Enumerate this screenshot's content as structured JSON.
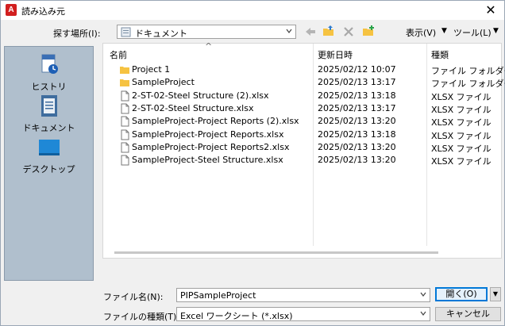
{
  "window": {
    "title": "読み込み元",
    "app_icon_letter": "A",
    "close_symbol": "✕"
  },
  "toolbar": {
    "lookin_label": "探す場所(I):",
    "lookin_value": "ドキュメント",
    "view_label": "表示(V)",
    "tools_label": "ツール(L)",
    "menu_arrow": "▼"
  },
  "places": [
    {
      "label": "ヒストリ",
      "icon": "history-icon"
    },
    {
      "label": "ドキュメント",
      "icon": "documents-icon"
    },
    {
      "label": "デスクトップ",
      "icon": "desktop-icon"
    }
  ],
  "columns": {
    "sort_arrow": "^",
    "name": "名前",
    "date": "更新日時",
    "type": "種類"
  },
  "files": [
    {
      "name": "Project 1",
      "date": "2025/02/12 10:07",
      "type": "ファイル フォルダー",
      "kind": "folder"
    },
    {
      "name": "SampleProject",
      "date": "2025/02/13 13:17",
      "type": "ファイル フォルダー",
      "kind": "folder"
    },
    {
      "name": "2-ST-02-Steel Structure (2).xlsx",
      "date": "2025/02/13 13:18",
      "type": "XLSX ファイル",
      "kind": "file"
    },
    {
      "name": "2-ST-02-Steel Structure.xlsx",
      "date": "2025/02/13 13:17",
      "type": "XLSX ファイル",
      "kind": "file"
    },
    {
      "name": "SampleProject-Project Reports (2).xlsx",
      "date": "2025/02/13 13:20",
      "type": "XLSX ファイル",
      "kind": "file"
    },
    {
      "name": "SampleProject-Project Reports.xlsx",
      "date": "2025/02/13 13:18",
      "type": "XLSX ファイル",
      "kind": "file"
    },
    {
      "name": "SampleProject-Project Reports2.xlsx",
      "date": "2025/02/13 13:20",
      "type": "XLSX ファイル",
      "kind": "file"
    },
    {
      "name": "SampleProject-Steel Structure.xlsx",
      "date": "2025/02/13 13:20",
      "type": "XLSX ファイル",
      "kind": "file"
    }
  ],
  "footer": {
    "filename_label": "ファイル名(N):",
    "filename_value": "PIPSampleProject",
    "filetype_label": "ファイルの種類(T):",
    "filetype_value": "Excel ワークシート (*.xlsx)",
    "open_label": "開く(O)",
    "cancel_label": "キャンセル"
  },
  "colors": {
    "places_bg": "#b0bfcd",
    "accent": "#0078d7",
    "folder": "#f6c342",
    "app_red": "#d21f1f"
  }
}
